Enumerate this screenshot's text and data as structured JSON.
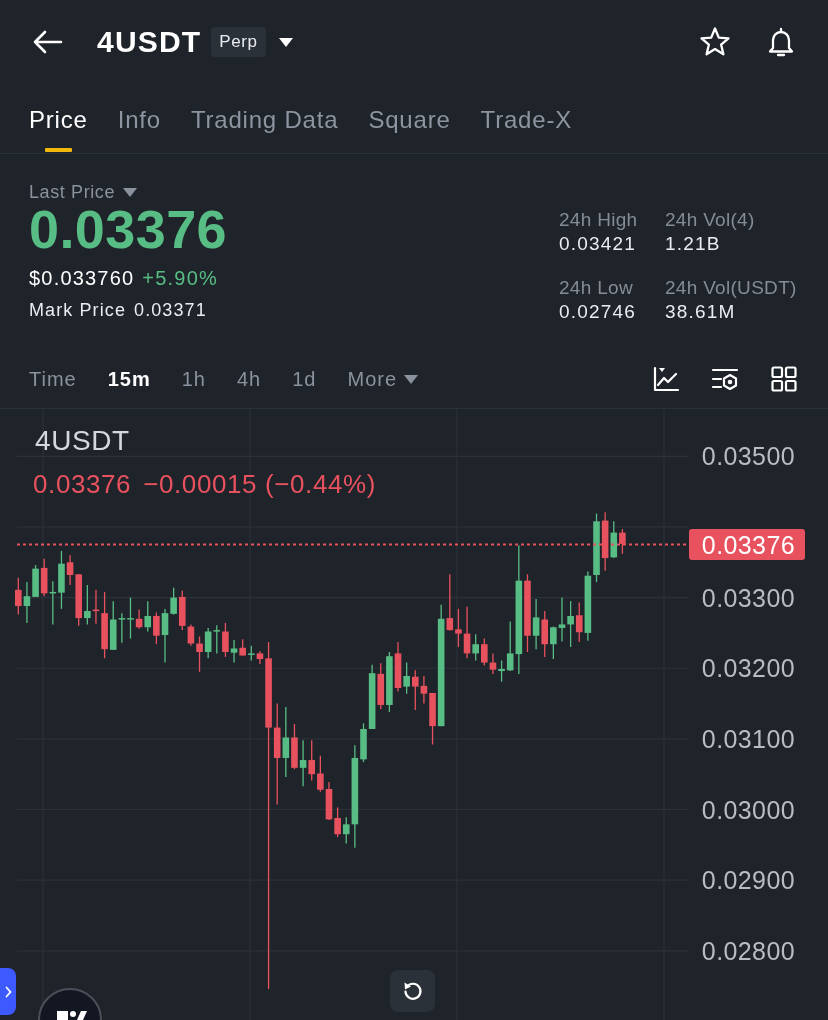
{
  "header": {
    "title": "4USDT",
    "badge": "Perp"
  },
  "tabs": [
    {
      "label": "Price",
      "selected": true
    },
    {
      "label": "Info",
      "selected": false
    },
    {
      "label": "Trading Data",
      "selected": false
    },
    {
      "label": "Square",
      "selected": false
    },
    {
      "label": "Trade-X",
      "selected": false
    }
  ],
  "summary": {
    "last_price_label": "Last Price",
    "last_price": "0.03376",
    "usd_price": "$0.033760",
    "change": "+5.90%",
    "mark_price_label": "Mark Price",
    "mark_price": "0.03371"
  },
  "stats": [
    {
      "label": "24h High",
      "value": "0.03421"
    },
    {
      "label": "24h Vol(4)",
      "value": "1.21B"
    },
    {
      "label": "24h Low",
      "value": "0.02746"
    },
    {
      "label": "24h Vol(USDT)",
      "value": "38.61M"
    }
  ],
  "intervals": [
    {
      "label": "Time",
      "kind": "option",
      "selected": false
    },
    {
      "label": "15m",
      "kind": "option",
      "selected": true
    },
    {
      "label": "1h",
      "kind": "option",
      "selected": false
    },
    {
      "label": "4h",
      "kind": "option",
      "selected": false
    },
    {
      "label": "1d",
      "kind": "option",
      "selected": false
    },
    {
      "label": "More",
      "kind": "menu",
      "selected": false
    }
  ],
  "chart": {
    "symbol": "4USDT",
    "legend_price": "0.03376",
    "legend_change": "−0.00015 (−0.44%)",
    "current_price": "0.03376",
    "chart_data": {
      "type": "candlestick",
      "grid": true,
      "ohlc": [
        [
          0.03311,
          0.03328,
          0.03276,
          0.03288
        ],
        [
          0.03288,
          0.03322,
          0.03264,
          0.03302
        ],
        [
          0.03301,
          0.03346,
          0.03301,
          0.03341
        ],
        [
          0.03342,
          0.03355,
          0.03302,
          0.03306
        ],
        [
          0.03306,
          0.03323,
          0.03262,
          0.03308
        ],
        [
          0.03307,
          0.03366,
          0.03284,
          0.03348
        ],
        [
          0.0335,
          0.0336,
          0.03318,
          0.03332
        ],
        [
          0.03333,
          0.03333,
          0.0326,
          0.03271
        ],
        [
          0.03271,
          0.03318,
          0.03262,
          0.03281
        ],
        [
          0.03283,
          0.03311,
          0.03263,
          0.03281
        ],
        [
          0.03278,
          0.03308,
          0.03214,
          0.03227
        ],
        [
          0.03226,
          0.03295,
          0.03226,
          0.03269
        ],
        [
          0.03269,
          0.03278,
          0.03236,
          0.03271
        ],
        [
          0.03269,
          0.033,
          0.03242,
          0.03271
        ],
        [
          0.0327,
          0.03283,
          0.03256,
          0.03258
        ],
        [
          0.03258,
          0.03295,
          0.03252,
          0.03274
        ],
        [
          0.03274,
          0.03279,
          0.03234,
          0.03246
        ],
        [
          0.03247,
          0.03284,
          0.03208,
          0.03278
        ],
        [
          0.03277,
          0.03314,
          0.03276,
          0.033
        ],
        [
          0.03301,
          0.0331,
          0.03254,
          0.0326
        ],
        [
          0.03259,
          0.03262,
          0.03232,
          0.03235
        ],
        [
          0.03235,
          0.03245,
          0.03195,
          0.03223
        ],
        [
          0.03223,
          0.03257,
          0.03214,
          0.03252
        ],
        [
          0.03252,
          0.03261,
          0.03221,
          0.03254
        ],
        [
          0.03252,
          0.03264,
          0.03216,
          0.03223
        ],
        [
          0.03222,
          0.0324,
          0.03208,
          0.03228
        ],
        [
          0.03229,
          0.03241,
          0.03218,
          0.03218
        ],
        [
          0.03219,
          0.03232,
          0.03211,
          0.03221
        ],
        [
          0.03221,
          0.03224,
          0.03206,
          0.03213
        ],
        [
          0.03214,
          0.03237,
          0.02746,
          0.03116
        ],
        [
          0.03116,
          0.0315,
          0.03007,
          0.03073
        ],
        [
          0.03073,
          0.03145,
          0.03046,
          0.03102
        ],
        [
          0.03102,
          0.03121,
          0.03057,
          0.03059
        ],
        [
          0.03059,
          0.03098,
          0.03033,
          0.0307
        ],
        [
          0.0307,
          0.03098,
          0.03041,
          0.0305
        ],
        [
          0.03051,
          0.03076,
          0.03025,
          0.03028
        ],
        [
          0.03029,
          0.03039,
          0.02985,
          0.02986
        ],
        [
          0.02988,
          0.03003,
          0.02961,
          0.02965
        ],
        [
          0.02965,
          0.02989,
          0.02952,
          0.02979
        ],
        [
          0.02979,
          0.03091,
          0.02946,
          0.03073
        ],
        [
          0.03071,
          0.03122,
          0.03067,
          0.03114
        ],
        [
          0.03114,
          0.03205,
          0.03114,
          0.03193
        ],
        [
          0.03192,
          0.03207,
          0.03142,
          0.03148
        ],
        [
          0.03148,
          0.03223,
          0.03138,
          0.03217
        ],
        [
          0.03221,
          0.03237,
          0.03167,
          0.03172
        ],
        [
          0.03174,
          0.03208,
          0.03164,
          0.03189
        ],
        [
          0.03188,
          0.03197,
          0.03141,
          0.03174
        ],
        [
          0.03175,
          0.03189,
          0.0315,
          0.03164
        ],
        [
          0.03165,
          0.03165,
          0.03092,
          0.03118
        ],
        [
          0.03118,
          0.0329,
          0.03118,
          0.0327
        ],
        [
          0.03271,
          0.03333,
          0.03253,
          0.03254
        ],
        [
          0.03255,
          0.03284,
          0.0323,
          0.03249
        ],
        [
          0.03249,
          0.03287,
          0.03214,
          0.03221
        ],
        [
          0.03221,
          0.03248,
          0.03211,
          0.03234
        ],
        [
          0.03234,
          0.03242,
          0.03204,
          0.03208
        ],
        [
          0.03208,
          0.03221,
          0.03192,
          0.03198
        ],
        [
          0.03196,
          0.03211,
          0.03181,
          0.03199
        ],
        [
          0.03197,
          0.03266,
          0.03196,
          0.03221
        ],
        [
          0.0322,
          0.03374,
          0.03192,
          0.03324
        ],
        [
          0.03324,
          0.03333,
          0.03223,
          0.03246
        ],
        [
          0.03246,
          0.03298,
          0.03227,
          0.03272
        ],
        [
          0.03269,
          0.03281,
          0.03216,
          0.03234
        ],
        [
          0.03234,
          0.03259,
          0.03213,
          0.03258
        ],
        [
          0.03257,
          0.033,
          0.03238,
          0.03262
        ],
        [
          0.03262,
          0.03295,
          0.0323,
          0.03274
        ],
        [
          0.03275,
          0.03293,
          0.03237,
          0.03251
        ],
        [
          0.0325,
          0.03337,
          0.03239,
          0.03331
        ],
        [
          0.03332,
          0.03419,
          0.03322,
          0.03408
        ],
        [
          0.03409,
          0.03421,
          0.03338,
          0.03356
        ],
        [
          0.03357,
          0.03408,
          0.03356,
          0.03392
        ],
        [
          0.03392,
          0.03397,
          0.03362,
          0.03376
        ]
      ],
      "ylim": [
        0.02702,
        0.03567
      ],
      "yticks": [
        {
          "value": 0.035,
          "label": "0.03500"
        },
        {
          "value": 0.033,
          "label": "0.03300"
        },
        {
          "value": 0.032,
          "label": "0.03200"
        },
        {
          "value": 0.031,
          "label": "0.03100"
        },
        {
          "value": 0.03,
          "label": "0.03000"
        },
        {
          "value": 0.029,
          "label": "0.02900"
        },
        {
          "value": 0.028,
          "label": "0.02800"
        }
      ]
    }
  }
}
